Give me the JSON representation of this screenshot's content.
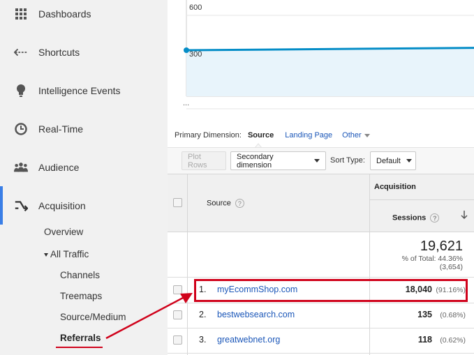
{
  "sidebar": {
    "items": [
      {
        "label": "Dashboards",
        "icon": "grid-icon"
      },
      {
        "label": "Shortcuts",
        "icon": "shortcut-arrow-icon"
      },
      {
        "label": "Intelligence Events",
        "icon": "lightbulb-icon"
      },
      {
        "label": "Real-Time",
        "icon": "clock-icon"
      },
      {
        "label": "Audience",
        "icon": "people-icon"
      },
      {
        "label": "Acquisition",
        "icon": "acquisition-arrows-icon"
      }
    ],
    "sub": {
      "overview": "Overview",
      "all_traffic": "All Traffic",
      "channels": "Channels",
      "treemaps": "Treemaps",
      "source_medium": "Source/Medium",
      "referrals": "Referrals"
    }
  },
  "chart_data": {
    "type": "area",
    "y_ticks": [
      "600",
      "300"
    ],
    "x_tick": "...",
    "line_color": "#058dc7",
    "fill_color": "#e8f4fb",
    "x": [
      0,
      1
    ],
    "values": [
      300,
      320
    ]
  },
  "primary_dimension": {
    "label": "Primary Dimension:",
    "current": "Source",
    "landing_page": "Landing Page",
    "other": "Other"
  },
  "toolbar": {
    "plot_rows": "Plot Rows",
    "secondary_dimension": "Secondary dimension",
    "sort_type_label": "Sort Type:",
    "sort_type_value": "Default"
  },
  "table": {
    "group_header": "Acquisition",
    "source_header": "Source",
    "sessions_header": "Sessions",
    "total": {
      "value": "19,621",
      "pct_text": "% of Total: 44.36%",
      "of_total": "(3,654)"
    },
    "rows": [
      {
        "num": "1.",
        "source": "myEcommShop.com",
        "sessions": "18,040",
        "pct": "(91.16%)"
      },
      {
        "num": "2.",
        "source": "bestwebsearch.com",
        "sessions": "135",
        "pct": "(0.68%)"
      },
      {
        "num": "3.",
        "source": "greatwebnet.org",
        "sessions": "118",
        "pct": "(0.62%)"
      }
    ]
  },
  "colors": {
    "highlight": "#d0021b",
    "link": "#1a56b8",
    "active_nav": "#3a7ee6"
  }
}
